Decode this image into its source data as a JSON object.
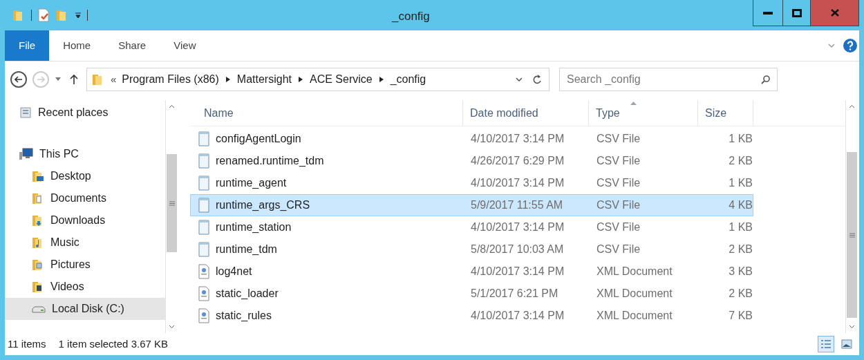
{
  "window": {
    "title": "_config"
  },
  "ribbon_tabs": [
    {
      "label": "File",
      "selected": true
    },
    {
      "label": "Home",
      "selected": false
    },
    {
      "label": "Share",
      "selected": false
    },
    {
      "label": "View",
      "selected": false
    }
  ],
  "address": {
    "overflow": "«",
    "segments": [
      "Program Files (x86)",
      "Mattersight",
      "ACE Service",
      "_config"
    ]
  },
  "search": {
    "placeholder": "Search _config"
  },
  "sidebar": {
    "items": [
      {
        "label": "Recent places",
        "kind": "recent",
        "selected": false
      },
      {
        "label": "This PC",
        "kind": "pc",
        "selected": false,
        "children": [
          {
            "label": "Desktop",
            "kind": "desktop",
            "selected": false
          },
          {
            "label": "Documents",
            "kind": "documents",
            "selected": false
          },
          {
            "label": "Downloads",
            "kind": "downloads",
            "selected": false
          },
          {
            "label": "Music",
            "kind": "music",
            "selected": false
          },
          {
            "label": "Pictures",
            "kind": "pictures",
            "selected": false
          },
          {
            "label": "Videos",
            "kind": "videos",
            "selected": false
          },
          {
            "label": "Local Disk (C:)",
            "kind": "disk",
            "selected": true
          }
        ]
      }
    ]
  },
  "table": {
    "columns": [
      {
        "label": "Name",
        "sorted": false
      },
      {
        "label": "Date modified",
        "sorted": false
      },
      {
        "label": "Type",
        "sorted": true
      },
      {
        "label": "Size",
        "sorted": false
      }
    ],
    "rows": [
      {
        "name": "configAgentLogin",
        "date": "4/10/2017 3:14 PM",
        "type": "CSV File",
        "size": "1 KB",
        "kind": "csv",
        "selected": false
      },
      {
        "name": "renamed.runtime_tdm",
        "date": "4/26/2017 6:29 PM",
        "type": "CSV File",
        "size": "2 KB",
        "kind": "csv",
        "selected": false
      },
      {
        "name": "runtime_agent",
        "date": "4/10/2017 3:14 PM",
        "type": "CSV File",
        "size": "1 KB",
        "kind": "csv",
        "selected": false
      },
      {
        "name": "runtime_args_CRS",
        "date": "5/9/2017 11:55 AM",
        "type": "CSV File",
        "size": "4 KB",
        "kind": "csv",
        "selected": true
      },
      {
        "name": "runtime_station",
        "date": "4/10/2017 3:14 PM",
        "type": "CSV File",
        "size": "1 KB",
        "kind": "csv",
        "selected": false
      },
      {
        "name": "runtime_tdm",
        "date": "5/8/2017 10:03 AM",
        "type": "CSV File",
        "size": "2 KB",
        "kind": "csv",
        "selected": false
      },
      {
        "name": "log4net",
        "date": "4/10/2017 3:14 PM",
        "type": "XML Document",
        "size": "3 KB",
        "kind": "xml",
        "selected": false
      },
      {
        "name": "static_loader",
        "date": "5/1/2017 6:21 PM",
        "type": "XML Document",
        "size": "2 KB",
        "kind": "xml",
        "selected": false
      },
      {
        "name": "static_rules",
        "date": "4/10/2017 3:14 PM",
        "type": "XML Document",
        "size": "7 KB",
        "kind": "xml",
        "selected": false
      }
    ]
  },
  "status_bar": {
    "count": "11 items",
    "selection": "1 item selected 3.67 KB"
  }
}
